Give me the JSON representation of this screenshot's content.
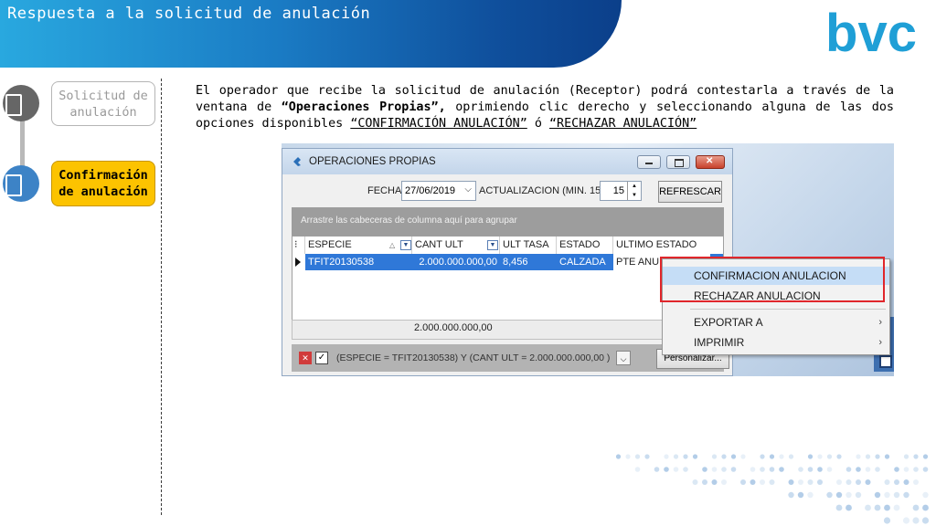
{
  "header": {
    "title": "Respuesta a la solicitud de anulación",
    "logo_text": "bvc"
  },
  "steps": [
    {
      "label": "Solicitud de anulación",
      "state": "inactive"
    },
    {
      "label": "Confirmación de anulación",
      "state": "active"
    }
  ],
  "description": {
    "part1": "El operador que recibe la solicitud de anulación (Receptor) podrá contestarla a través de la ventana de ",
    "bold": "“Operaciones Propias”,",
    "part2": " oprimiendo clic derecho y seleccionando alguna de las dos opciones disponibles ",
    "opt1": "“CONFIRMACIÓN ANULACIÓN”",
    "part3": " ó ",
    "opt2": "“RECHAZAR ANULACIÓN”"
  },
  "window": {
    "title": "OPERACIONES PROPIAS",
    "fecha_label": "FECHA",
    "fecha_value": "27/06/2019",
    "actualizacion_label": "ACTUALIZACION (MIN. 15)",
    "actualizacion_value": "15",
    "refresh_button": "REFRESCAR",
    "group_hint": "Arrastre las cabeceras de columna aquí para agrupar",
    "columns": [
      "ESPECIE",
      "CANT ULT",
      "ULT TASA",
      "ESTADO",
      "ULTIMO ESTADO"
    ],
    "row": {
      "especie": "TFIT20130538",
      "cant_ult": "2.000.000.000,00",
      "ult_tasa": "8,456",
      "estado": "CALZADA",
      "ultimo_estado": "PTE ANULACION"
    },
    "footer_sum": "2.000.000.000,00",
    "filter_text": "(ESPECIE = TFIT20130538) Y (CANT ULT = 2.000.000.000,00 )",
    "customize_button": "Personalizar..."
  },
  "context_menu": {
    "items": [
      {
        "label": "CONFIRMACION ANULACION",
        "highlighted": true
      },
      {
        "label": "RECHAZAR ANULACION",
        "highlighted": false
      },
      {
        "label": "EXPORTAR A",
        "submenu": true
      },
      {
        "label": "IMPRIMIR",
        "submenu": true
      }
    ]
  },
  "colors": {
    "header_blue": "#1a7bc4",
    "active_step": "#fcc300",
    "selection": "#2f78d8",
    "highlight_box": "#e0262b"
  }
}
